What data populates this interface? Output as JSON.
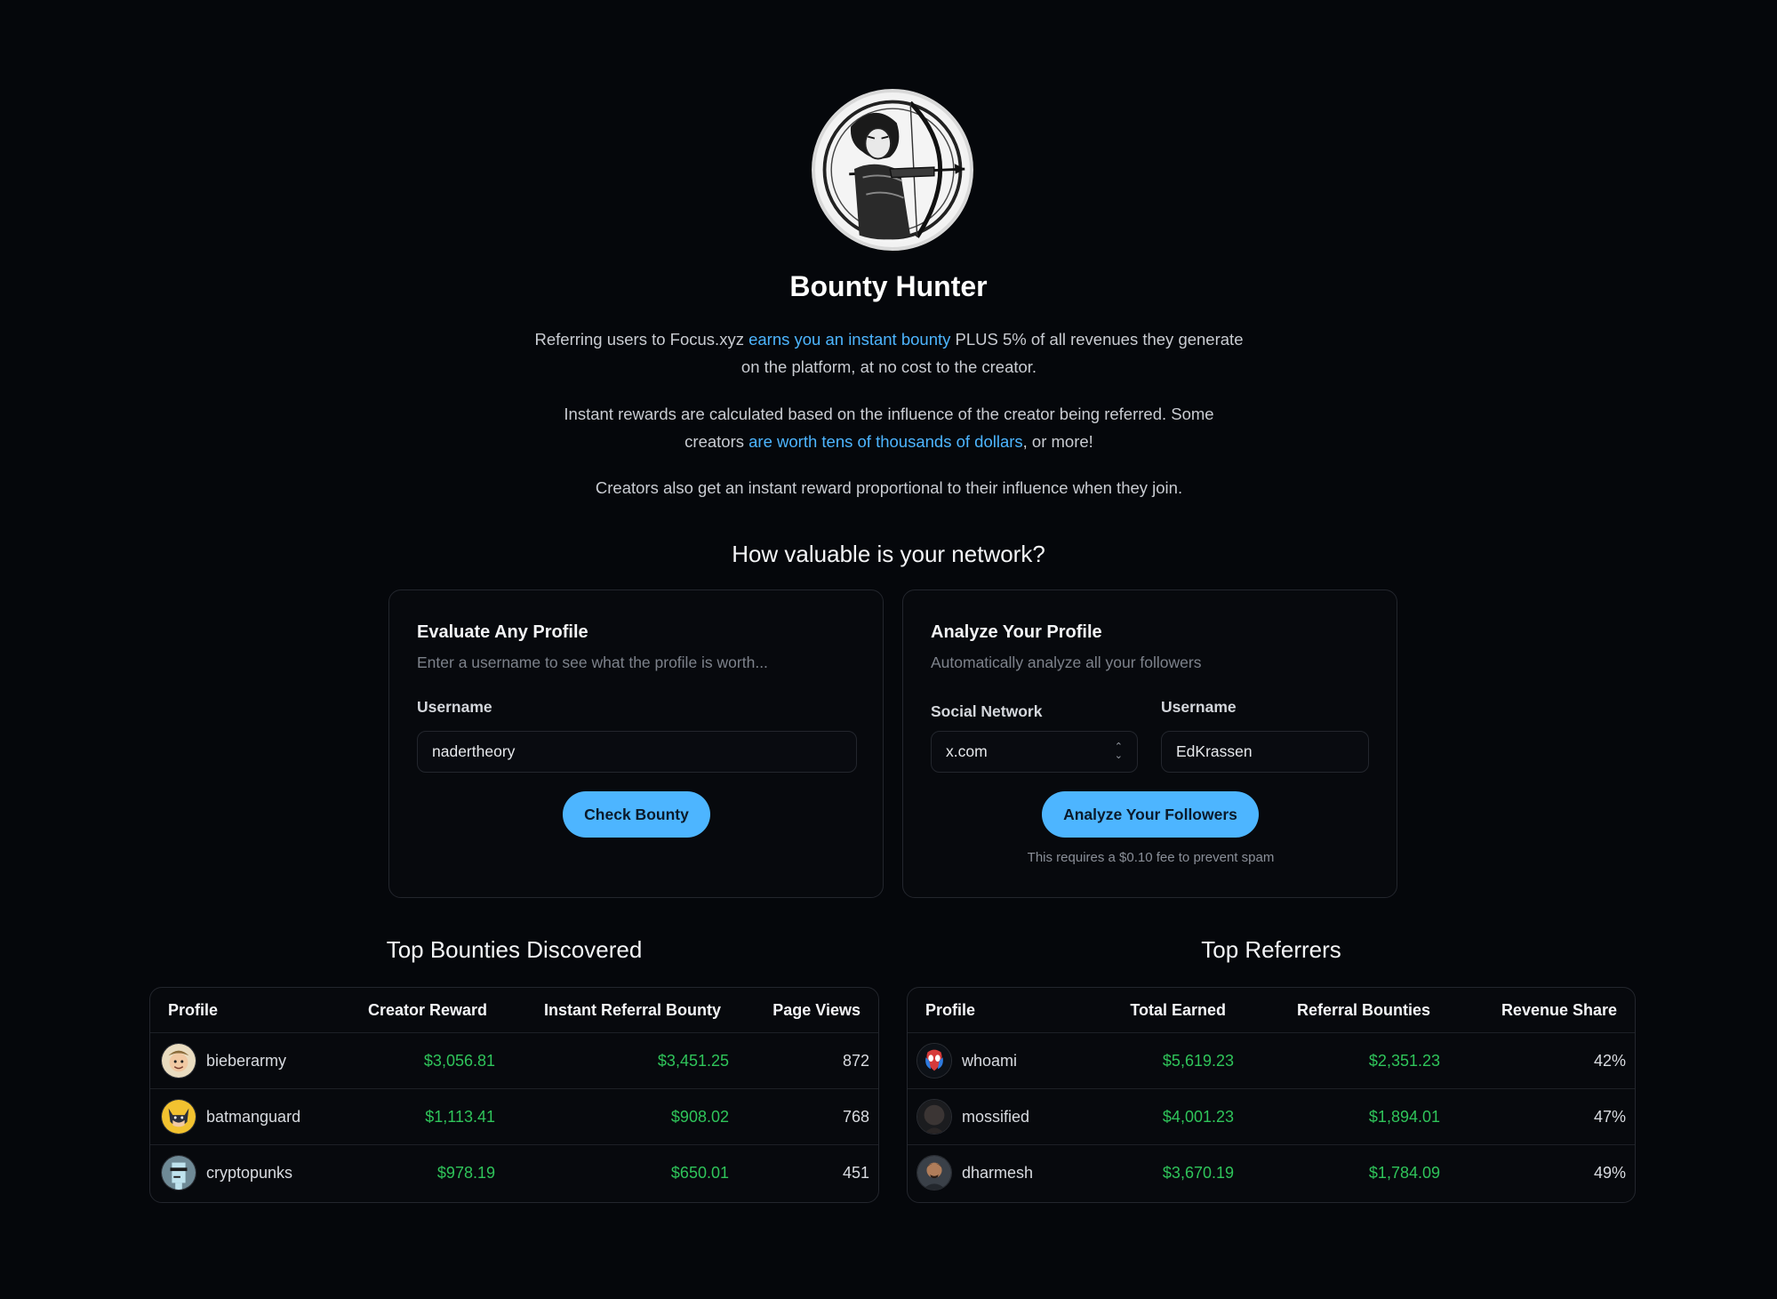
{
  "hero": {
    "title": "Bounty Hunter",
    "p1_a": "Referring users to Focus.xyz ",
    "p1_link": "earns you an instant bounty",
    "p1_b": " PLUS 5% of all revenues they generate on the platform, at no cost to the creator.",
    "p2_a": "Instant rewards are calculated based on the influence of the creator being referred. Some creators ",
    "p2_link": "are worth tens of thousands of dollars",
    "p2_b": ", or more!",
    "p3": "Creators also get an instant reward proportional to their influence when they join.",
    "question": "How valuable is your network?"
  },
  "evaluate": {
    "title": "Evaluate Any Profile",
    "subtitle": "Enter a username to see what the profile is worth...",
    "username_label": "Username",
    "username_value": "nadertheory",
    "button": "Check Bounty"
  },
  "analyze": {
    "title": "Analyze Your Profile",
    "subtitle": "Automatically analyze all your followers",
    "network_label": "Social Network",
    "network_value": "x.com",
    "username_label": "Username",
    "username_value": "EdKrassen",
    "button": "Analyze Your Followers",
    "fee_note": "This requires a $0.10 fee to prevent spam"
  },
  "top_bounties": {
    "title": "Top Bounties Discovered",
    "headers": [
      "Profile",
      "Creator Reward",
      "Instant Referral Bounty",
      "Page Views"
    ],
    "rows": [
      {
        "profile": "bieberarmy",
        "creator_reward": "$3,056.81",
        "referral_bounty": "$3,451.25",
        "page_views": "872",
        "avatar": "cartoon-face-avatar"
      },
      {
        "profile": "batmanguard",
        "creator_reward": "$1,113.41",
        "referral_bounty": "$908.02",
        "page_views": "768",
        "avatar": "batman-avatar"
      },
      {
        "profile": "cryptopunks",
        "creator_reward": "$978.19",
        "referral_bounty": "$650.01",
        "page_views": "451",
        "avatar": "punk-avatar"
      }
    ]
  },
  "top_referrers": {
    "title": "Top Referrers",
    "headers": [
      "Profile",
      "Total Earned",
      "Referral Bounties",
      "Revenue Share"
    ],
    "rows": [
      {
        "profile": "whoami",
        "total_earned": "$5,619.23",
        "referral_bounties": "$2,351.23",
        "revenue_share": "42%",
        "avatar": "spider-avatar"
      },
      {
        "profile": "mossified",
        "total_earned": "$4,001.23",
        "referral_bounties": "$1,894.01",
        "revenue_share": "47%",
        "avatar": "dark-portrait-avatar"
      },
      {
        "profile": "dharmesh",
        "total_earned": "$3,670.19",
        "referral_bounties": "$1,784.09",
        "revenue_share": "49%",
        "avatar": "man-portrait-avatar"
      }
    ]
  },
  "colors": {
    "background": "#05070b",
    "accent": "#4db5ff",
    "money": "#2fc45a",
    "border": "#23262d"
  }
}
